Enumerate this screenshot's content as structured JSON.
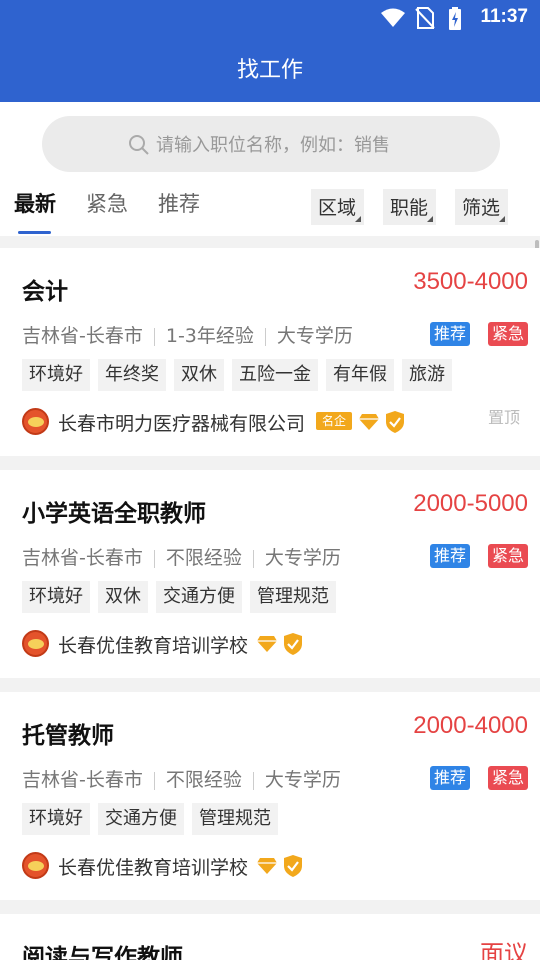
{
  "status": {
    "time": "11:37"
  },
  "header": {
    "title": "找工作"
  },
  "search": {
    "placeholder": "请输入职位名称，例如：销售"
  },
  "tabs": [
    "最新",
    "紧急",
    "推荐"
  ],
  "filters": [
    "区域",
    "职能",
    "筛选"
  ],
  "colors": {
    "primary": "#2f63cf",
    "salary": "#e54343",
    "recommend_badge": "#2f84e6",
    "urgent_badge": "#ea4b52"
  },
  "jobs": [
    {
      "title": "会计",
      "salary": "3500-4000",
      "location": "吉林省-长春市",
      "experience": "1-3年经验",
      "education": "大专学历",
      "badges": [
        "推荐",
        "紧急"
      ],
      "tags": [
        "环境好",
        "年终奖",
        "双休",
        "五险一金",
        "有年假",
        "旅游"
      ],
      "company": "长春市明力医疗器械有限公司",
      "company_badge": "名企",
      "pin": "置顶"
    },
    {
      "title": "小学英语全职教师",
      "salary": "2000-5000",
      "location": "吉林省-长春市",
      "experience": "不限经验",
      "education": "大专学历",
      "badges": [
        "推荐",
        "紧急"
      ],
      "tags": [
        "环境好",
        "双休",
        "交通方便",
        "管理规范"
      ],
      "company": "长春优佳教育培训学校"
    },
    {
      "title": "托管教师",
      "salary": "2000-4000",
      "location": "吉林省-长春市",
      "experience": "不限经验",
      "education": "大专学历",
      "badges": [
        "推荐",
        "紧急"
      ],
      "tags": [
        "环境好",
        "交通方便",
        "管理规范"
      ],
      "company": "长春优佳教育培训学校"
    },
    {
      "title": "阅读与写作教师",
      "salary": "面议"
    }
  ]
}
